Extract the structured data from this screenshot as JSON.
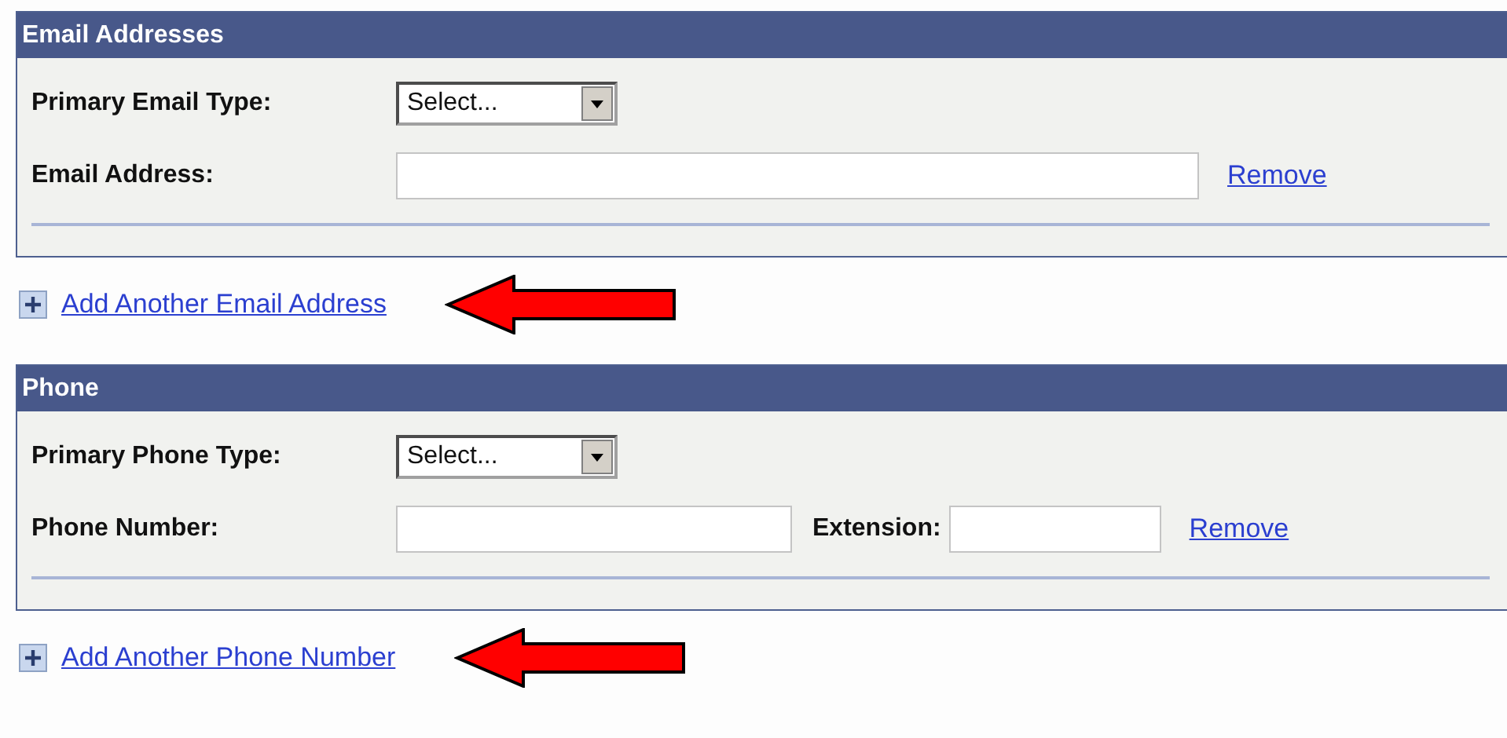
{
  "sections": [
    {
      "title": "Email Addresses",
      "rows": [
        {
          "kind": "select",
          "label": "Primary Email Type:",
          "value": "Select..."
        },
        {
          "kind": "email",
          "label": "Email Address:",
          "link": "Remove"
        }
      ],
      "add_link": {
        "label": "Add Another Email Address",
        "highlighted": true
      }
    },
    {
      "title": "Phone",
      "rows": [
        {
          "kind": "select",
          "label": "Primary Phone Type:",
          "value": "Select..."
        },
        {
          "kind": "phone",
          "label": "Phone Number:",
          "extension_label": "Extension:",
          "link": "Remove"
        }
      ],
      "add_link": {
        "label": "Add Another Phone Number",
        "highlighted": true
      }
    }
  ]
}
